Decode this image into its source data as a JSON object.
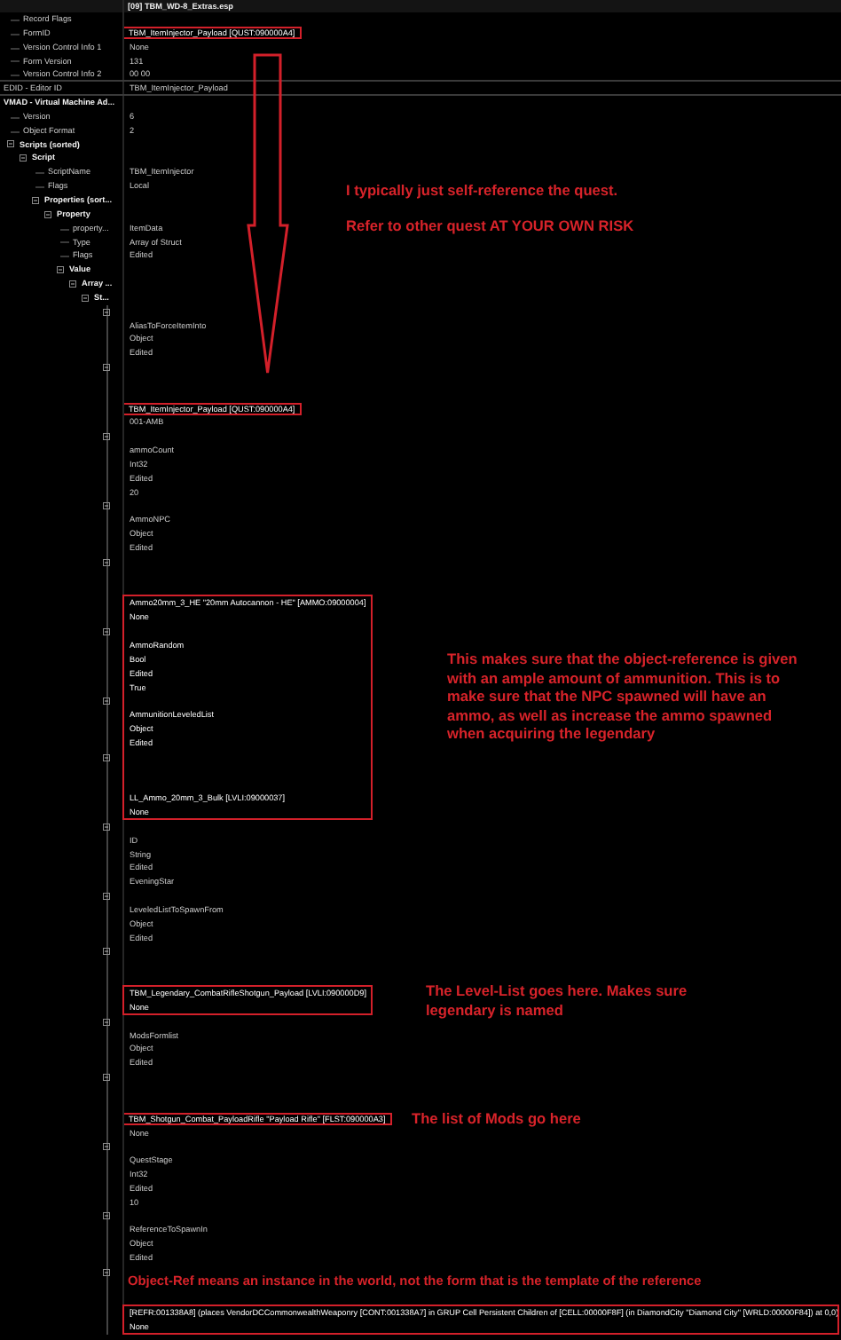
{
  "file_title": "[09] TBM_WD-8_Extras.esp",
  "record_header": [
    {
      "label": "Record Flags"
    },
    {
      "label": "FormID",
      "value": "TBM_ItemInjector_Payload [QUST:090000A4]",
      "boxed": true
    },
    {
      "label": "Version Control Info 1",
      "value": "None",
      "boxed": false
    },
    {
      "label": "Form Version",
      "value": "131",
      "boxed": false
    },
    {
      "label": "Version Control Info 2",
      "value": "00 00",
      "boxed": false
    }
  ],
  "editor_id": {
    "label": "EDID - Editor ID",
    "value": "TBM_ItemInjector_Payload"
  },
  "vmad": {
    "label": "VMAD - Virtual Machine Ad...",
    "children": [
      {
        "label": "Version",
        "value": "6"
      },
      {
        "label": "Object Format",
        "value": "2"
      },
      {
        "label": "Scripts (sorted)",
        "expanded": true,
        "children": [
          {
            "label": "Script",
            "expanded": true,
            "children": [
              {
                "label": "ScriptName",
                "value": "TBM_ItemInjector"
              },
              {
                "label": "Flags",
                "value": "Local"
              },
              {
                "label": "Properties (sort...",
                "expanded": true,
                "children": [
                  {
                    "label": "Property",
                    "expanded": true,
                    "children": [
                      {
                        "label": "property...",
                        "value": "ItemData"
                      },
                      {
                        "label": "Type",
                        "value": "Array of Struct"
                      },
                      {
                        "label": "Flags",
                        "value": "Edited"
                      },
                      {
                        "label": "Value",
                        "expanded": true,
                        "children": [
                          {
                            "label": "Array ...",
                            "expanded": true,
                            "children": [
                              {
                                "label": "St...",
                                "expanded": true,
                                "members": [
                                  {
                                    "kind": "object",
                                    "lines": [
                                      {
                                        "text": "AliasToForceItemInto",
                                        "boxed": false
                                      },
                                      {
                                        "text": "Object",
                                        "boxed": false
                                      },
                                      {
                                        "text": "Edited",
                                        "boxed": false
                                      },
                                      {
                                        "text": "TBM_ItemInjector_Payload [QUST:090000A4]",
                                        "boxed": true
                                      },
                                      {
                                        "text": "001-AMB",
                                        "boxed": false
                                      }
                                    ]
                                  },
                                  {
                                    "kind": "scalar",
                                    "lines": [
                                      {
                                        "text": "ammoCount",
                                        "boxed": false
                                      },
                                      {
                                        "text": "Int32",
                                        "boxed": false
                                      },
                                      {
                                        "text": "Edited",
                                        "boxed": false
                                      },
                                      {
                                        "text": "20",
                                        "boxed": false
                                      }
                                    ]
                                  },
                                  {
                                    "kind": "object",
                                    "lines": [
                                      {
                                        "text": "AmmoNPC",
                                        "boxed": false
                                      },
                                      {
                                        "text": "Object",
                                        "boxed": false
                                      },
                                      {
                                        "text": "Edited",
                                        "boxed": false
                                      },
                                      {
                                        "text": "Ammo20mm_3_HE \"20mm Autocannon - HE\" [AMMO:09000004]",
                                        "boxed": true
                                      },
                                      {
                                        "text": "None",
                                        "boxed": true
                                      }
                                    ]
                                  },
                                  {
                                    "kind": "scalar",
                                    "lines": [
                                      {
                                        "text": "AmmoRandom",
                                        "boxed": true
                                      },
                                      {
                                        "text": "Bool",
                                        "boxed": true
                                      },
                                      {
                                        "text": "Edited",
                                        "boxed": true
                                      },
                                      {
                                        "text": "True",
                                        "boxed": true
                                      }
                                    ]
                                  },
                                  {
                                    "kind": "object",
                                    "lines": [
                                      {
                                        "text": "AmmunitionLeveledList",
                                        "boxed": true
                                      },
                                      {
                                        "text": "Object",
                                        "boxed": true
                                      },
                                      {
                                        "text": "Edited",
                                        "boxed": true
                                      },
                                      {
                                        "text": "LL_Ammo_20mm_3_Bulk [LVLI:09000037]",
                                        "boxed": true
                                      },
                                      {
                                        "text": "None",
                                        "boxed": true
                                      }
                                    ]
                                  },
                                  {
                                    "kind": "scalar",
                                    "lines": [
                                      {
                                        "text": "ID",
                                        "boxed": false
                                      },
                                      {
                                        "text": "String",
                                        "boxed": false
                                      },
                                      {
                                        "text": "Edited",
                                        "boxed": false
                                      },
                                      {
                                        "text": "EveningStar",
                                        "boxed": false
                                      }
                                    ]
                                  },
                                  {
                                    "kind": "object",
                                    "lines": [
                                      {
                                        "text": "LeveledListToSpawnFrom",
                                        "boxed": false
                                      },
                                      {
                                        "text": "Object",
                                        "boxed": false
                                      },
                                      {
                                        "text": "Edited",
                                        "boxed": false
                                      },
                                      {
                                        "text": "TBM_Legendary_CombatRifleShotgun_Payload [LVLI:090000D9]",
                                        "boxed": true
                                      },
                                      {
                                        "text": "None",
                                        "boxed": true
                                      }
                                    ]
                                  },
                                  {
                                    "kind": "object",
                                    "lines": [
                                      {
                                        "text": "ModsFormlist",
                                        "boxed": false
                                      },
                                      {
                                        "text": "Object",
                                        "boxed": false
                                      },
                                      {
                                        "text": "Edited",
                                        "boxed": false
                                      },
                                      {
                                        "text": "TBM_Shotgun_Combat_PayloadRifle \"Payload Rifle\" [FLST:090000A3]",
                                        "boxed": true
                                      },
                                      {
                                        "text": "None",
                                        "boxed": false
                                      }
                                    ]
                                  },
                                  {
                                    "kind": "scalar",
                                    "lines": [
                                      {
                                        "text": "QuestStage",
                                        "boxed": false
                                      },
                                      {
                                        "text": "Int32",
                                        "boxed": false
                                      },
                                      {
                                        "text": "Edited",
                                        "boxed": false
                                      },
                                      {
                                        "text": "10",
                                        "boxed": false
                                      }
                                    ]
                                  },
                                  {
                                    "kind": "object",
                                    "lines": [
                                      {
                                        "text": "ReferenceToSpawnIn",
                                        "boxed": false
                                      },
                                      {
                                        "text": "Object",
                                        "boxed": false
                                      },
                                      {
                                        "text": "Edited",
                                        "boxed": false
                                      },
                                      {
                                        "text": "[REFR:001338A8] (places VendorDCCommonwealthWeaponry [CONT:001338A7] in GRUP Cell Persistent Children of [CELL:00000F8F] (in DiamondCity \"Diamond City\" [WRLD:00000F84]) at 0,0)",
                                        "boxed": true
                                      },
                                      {
                                        "text": "None",
                                        "boxed": true
                                      }
                                    ]
                                  }
                                ]
                              }
                            ]
                          }
                        ]
                      }
                    ]
                  }
                ]
              }
            ]
          }
        ]
      }
    ]
  },
  "annotations": [
    "I typically just self-reference the quest.",
    "Refer to other quest AT YOUR OWN RISK",
    "This makes sure that the object-reference is given with an ample amount of ammunition. This is to make sure that the NPC spawned will have an ammo, as well as increase the ammo spawned when acquiring the legendary",
    "The Level-List goes here. Makes sure legendary is named",
    "The list of Mods go here",
    "Object-Ref means an instance in the world, not the form that is the template of the reference"
  ]
}
